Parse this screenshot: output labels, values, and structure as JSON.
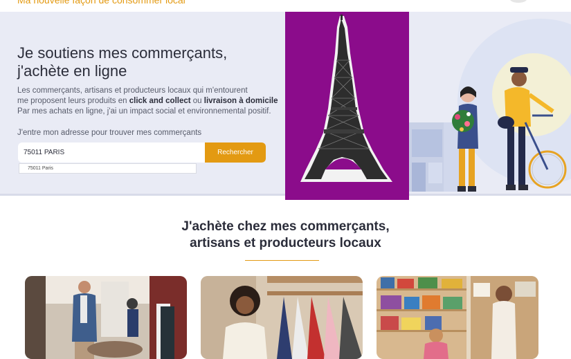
{
  "header": {
    "tagline": "Ma nouvelle façon de consommer local"
  },
  "hero": {
    "title_line1": "Je soutiens mes commerçants,",
    "title_line2": "j'achète en ligne",
    "desc_line1": "Les commerçants, artisans et producteurs locaux qui m'entourent",
    "desc_line2_a": "me proposent leurs produits en ",
    "desc_line2_b": "click and collect",
    "desc_line2_c": " ou ",
    "desc_line2_d": "livraison à domicile",
    "desc_line3": "Par mes achats en ligne, j'ai un impact social et environnemental positif.",
    "address_prompt": "J'entre mon adresse pour trouver mes commerçants",
    "search": {
      "value": "75011 PARIS",
      "button_label": "Rechercher",
      "suggestion": "75011 Paris"
    }
  },
  "section": {
    "title_line1": "J'achète chez mes commerçants,",
    "title_line2": "artisans et producteurs locaux"
  },
  "colors": {
    "accent": "#e39a12",
    "hero_bg": "#e9ebf5",
    "eiffel_panel": "#8b0c8b",
    "text_dark": "#2b2d3a"
  },
  "icons": {
    "account": "user-icon"
  }
}
